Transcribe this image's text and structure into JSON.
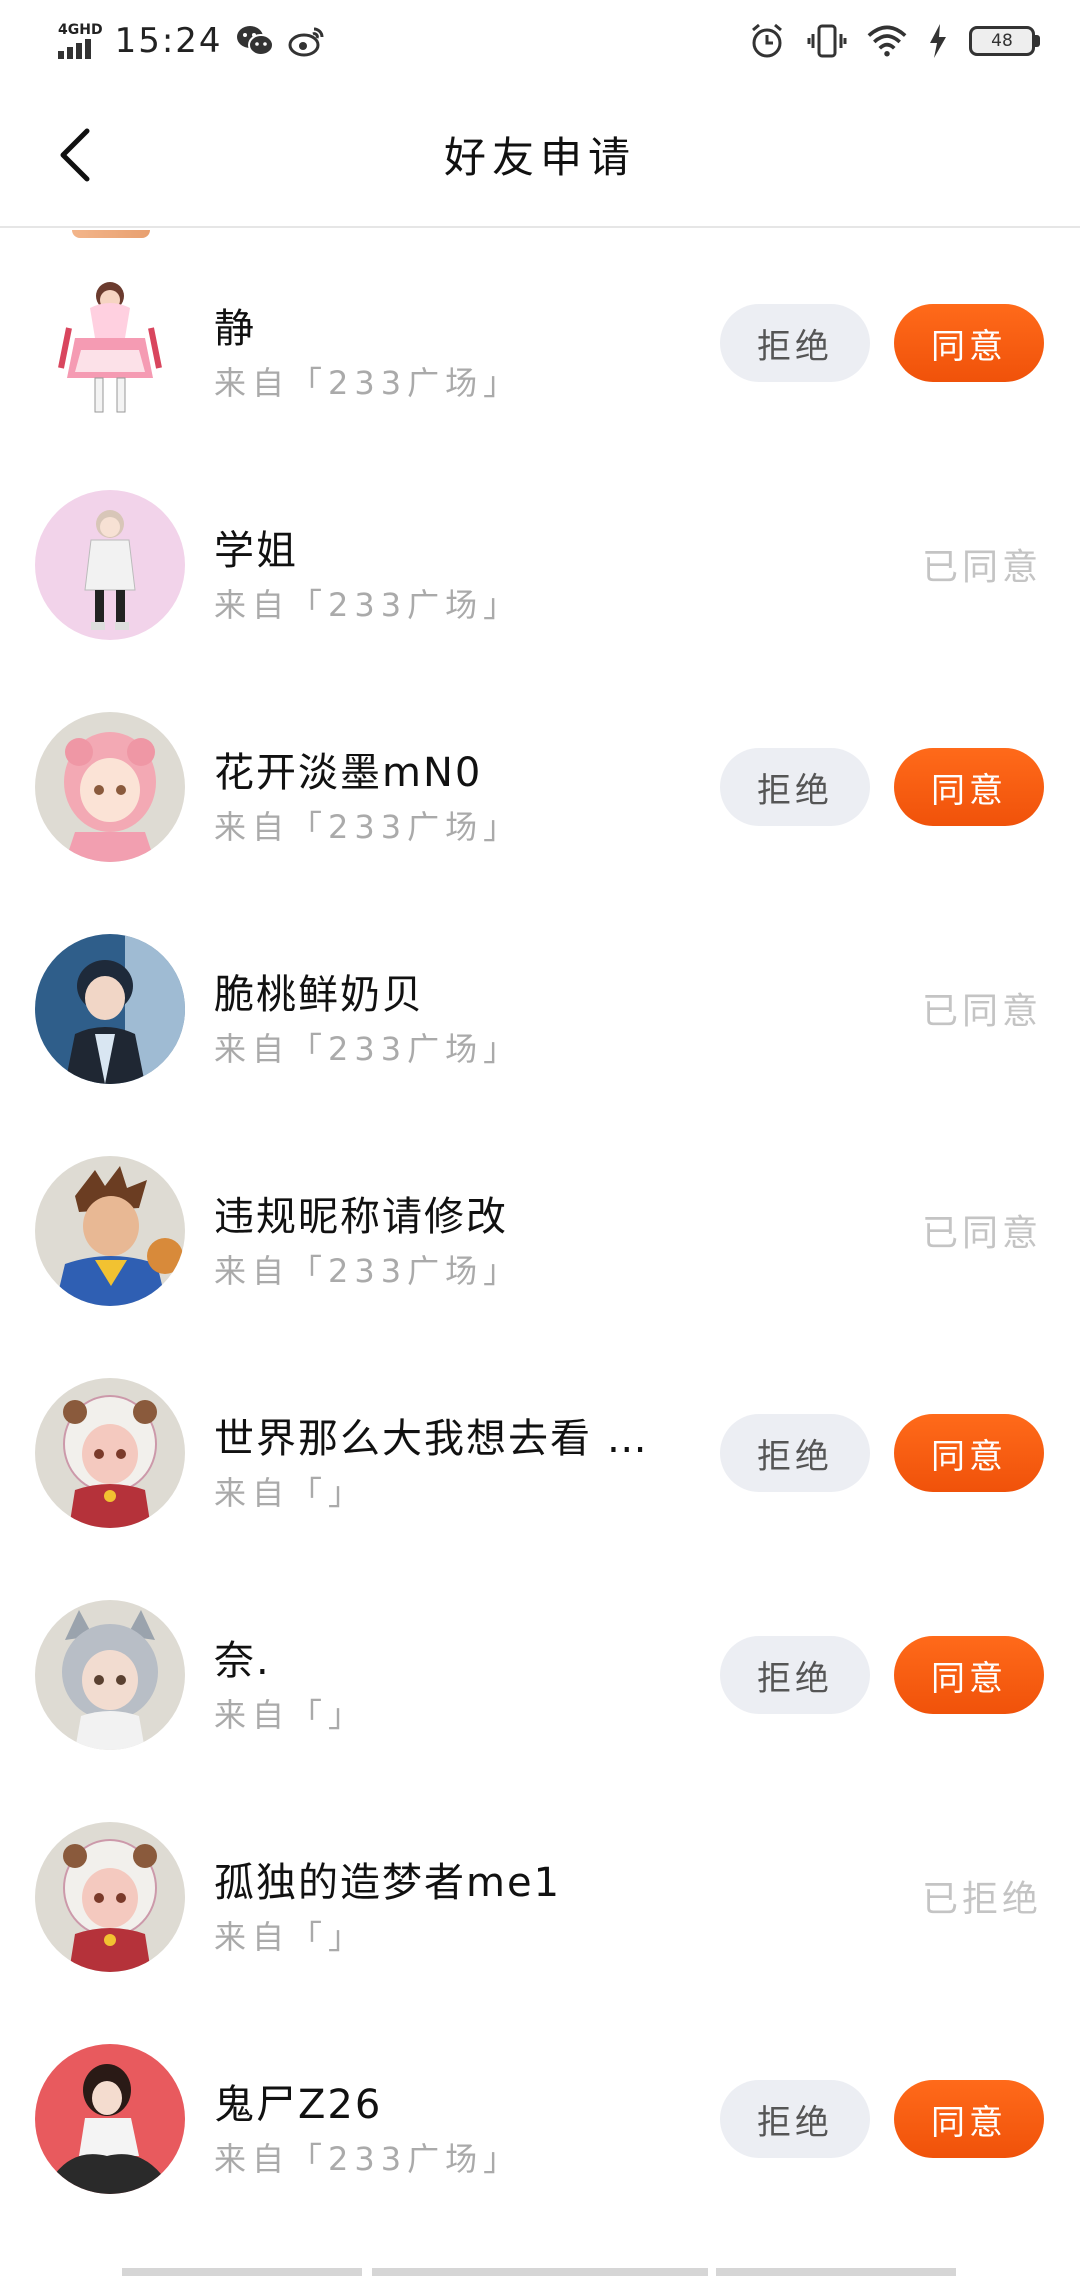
{
  "status_bar": {
    "network": "4GHD",
    "time": "15:24",
    "battery": "48"
  },
  "header": {
    "title": "好友申请"
  },
  "requests": [
    {
      "name": "静",
      "source": "来自「233广场」",
      "status": "pending",
      "status_label": "",
      "avatar_bg": "#ffffff"
    },
    {
      "name": "学姐",
      "source": "来自「233广场」",
      "status": "accepted",
      "status_label": "已同意",
      "avatar_bg": "#f2d3ea"
    },
    {
      "name": "花开淡墨mN0",
      "source": "来自「233广场」",
      "status": "pending",
      "status_label": "",
      "avatar_bg": "#dedbd3"
    },
    {
      "name": "脆桃鲜奶贝",
      "source": "来自「233广场」",
      "status": "accepted",
      "status_label": "已同意",
      "avatar_bg": "#2f5e8a"
    },
    {
      "name": "违规昵称请修改",
      "source": "来自「233广场」",
      "status": "accepted",
      "status_label": "已同意",
      "avatar_bg": "#dedbd3"
    },
    {
      "name": "世界那么大我想去看 …",
      "source": "来自「」",
      "status": "pending",
      "status_label": "",
      "avatar_bg": "#dedbd3"
    },
    {
      "name": "奈.",
      "source": "来自「」",
      "status": "pending",
      "status_label": "",
      "avatar_bg": "#dedbd3"
    },
    {
      "name": "孤独的造梦者me1",
      "source": "来自「」",
      "status": "rejected",
      "status_label": "已拒绝",
      "avatar_bg": "#dedbd3"
    },
    {
      "name": "鬼尸Z26",
      "source": "来自「233广场」",
      "status": "pending",
      "status_label": "",
      "avatar_bg": "#e85a5e"
    }
  ],
  "buttons": {
    "reject_label": "拒绝",
    "accept_label": "同意"
  },
  "colors": {
    "accent": "#f45d12",
    "reject_bg": "#eceef3",
    "muted_text": "#aaaaaa",
    "status_text": "#c4c4c4"
  },
  "icons": {
    "back": "chevron-left-icon",
    "wechat": "wechat-icon",
    "weibo": "weibo-icon",
    "alarm": "alarm-icon",
    "vibrate": "vibrate-icon",
    "wifi": "wifi-icon",
    "charging": "charging-icon"
  }
}
